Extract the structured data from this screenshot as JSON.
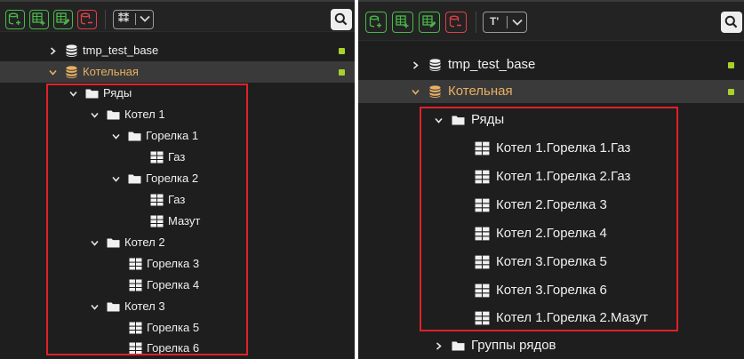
{
  "colors": {
    "panel_bg": "#1e1e1e",
    "selected_row": "#3a3a3a",
    "accent_green": "#49b84a",
    "accent_red": "#e0404a",
    "highlight_red": "#e0202a",
    "status_dot": "#a8d22a",
    "orange_text": "#e9b064"
  },
  "toolbar_icons": [
    "add-database-icon",
    "add-table-icon",
    "edit-table-icon",
    "remove-database-icon",
    "view-mode-dropdown",
    "search-icon"
  ],
  "left_pane": {
    "toolbar": {
      "view_glyph": "⁑⁑"
    },
    "tree": {
      "root_items": [
        {
          "label": "tmp_test_base",
          "icon": "database-icon",
          "expanded": false
        },
        {
          "label": "Котельная",
          "icon": "database-icon",
          "expanded": true,
          "selected": true
        }
      ],
      "rows_folder": "Ряды",
      "kotel_1": "Котел 1",
      "gorelka_1": "Горелка 1",
      "gaz_1": "Газ",
      "gorelka_2": "Горелка 2",
      "gaz_2": "Газ",
      "mazut": "Мазут",
      "kotel_2": "Котел 2",
      "gorelka_3": "Горелка 3",
      "gorelka_4": "Горелка 4",
      "kotel_3": "Котел 3",
      "gorelka_5": "Горелка 5",
      "gorelka_6": "Горелка 6"
    }
  },
  "right_pane": {
    "toolbar": {
      "view_glyph": "T'"
    },
    "tree": {
      "root_items": [
        {
          "label": "tmp_test_base",
          "icon": "database-icon",
          "expanded": false
        },
        {
          "label": "Котельная",
          "icon": "database-icon",
          "expanded": true,
          "selected": true
        }
      ],
      "rows_folder": "Ряды",
      "flat_items": [
        "Котел 1.Горелка 1.Газ",
        "Котел 1.Горелка 2.Газ",
        "Котел 2.Горелка 3",
        "Котел 2.Горелка 4",
        "Котел 3.Горелка 5",
        "Котел 3.Горелка 6",
        "Котел 1.Горелка 2.Мазут"
      ],
      "groups_folder": "Группы рядов"
    }
  }
}
